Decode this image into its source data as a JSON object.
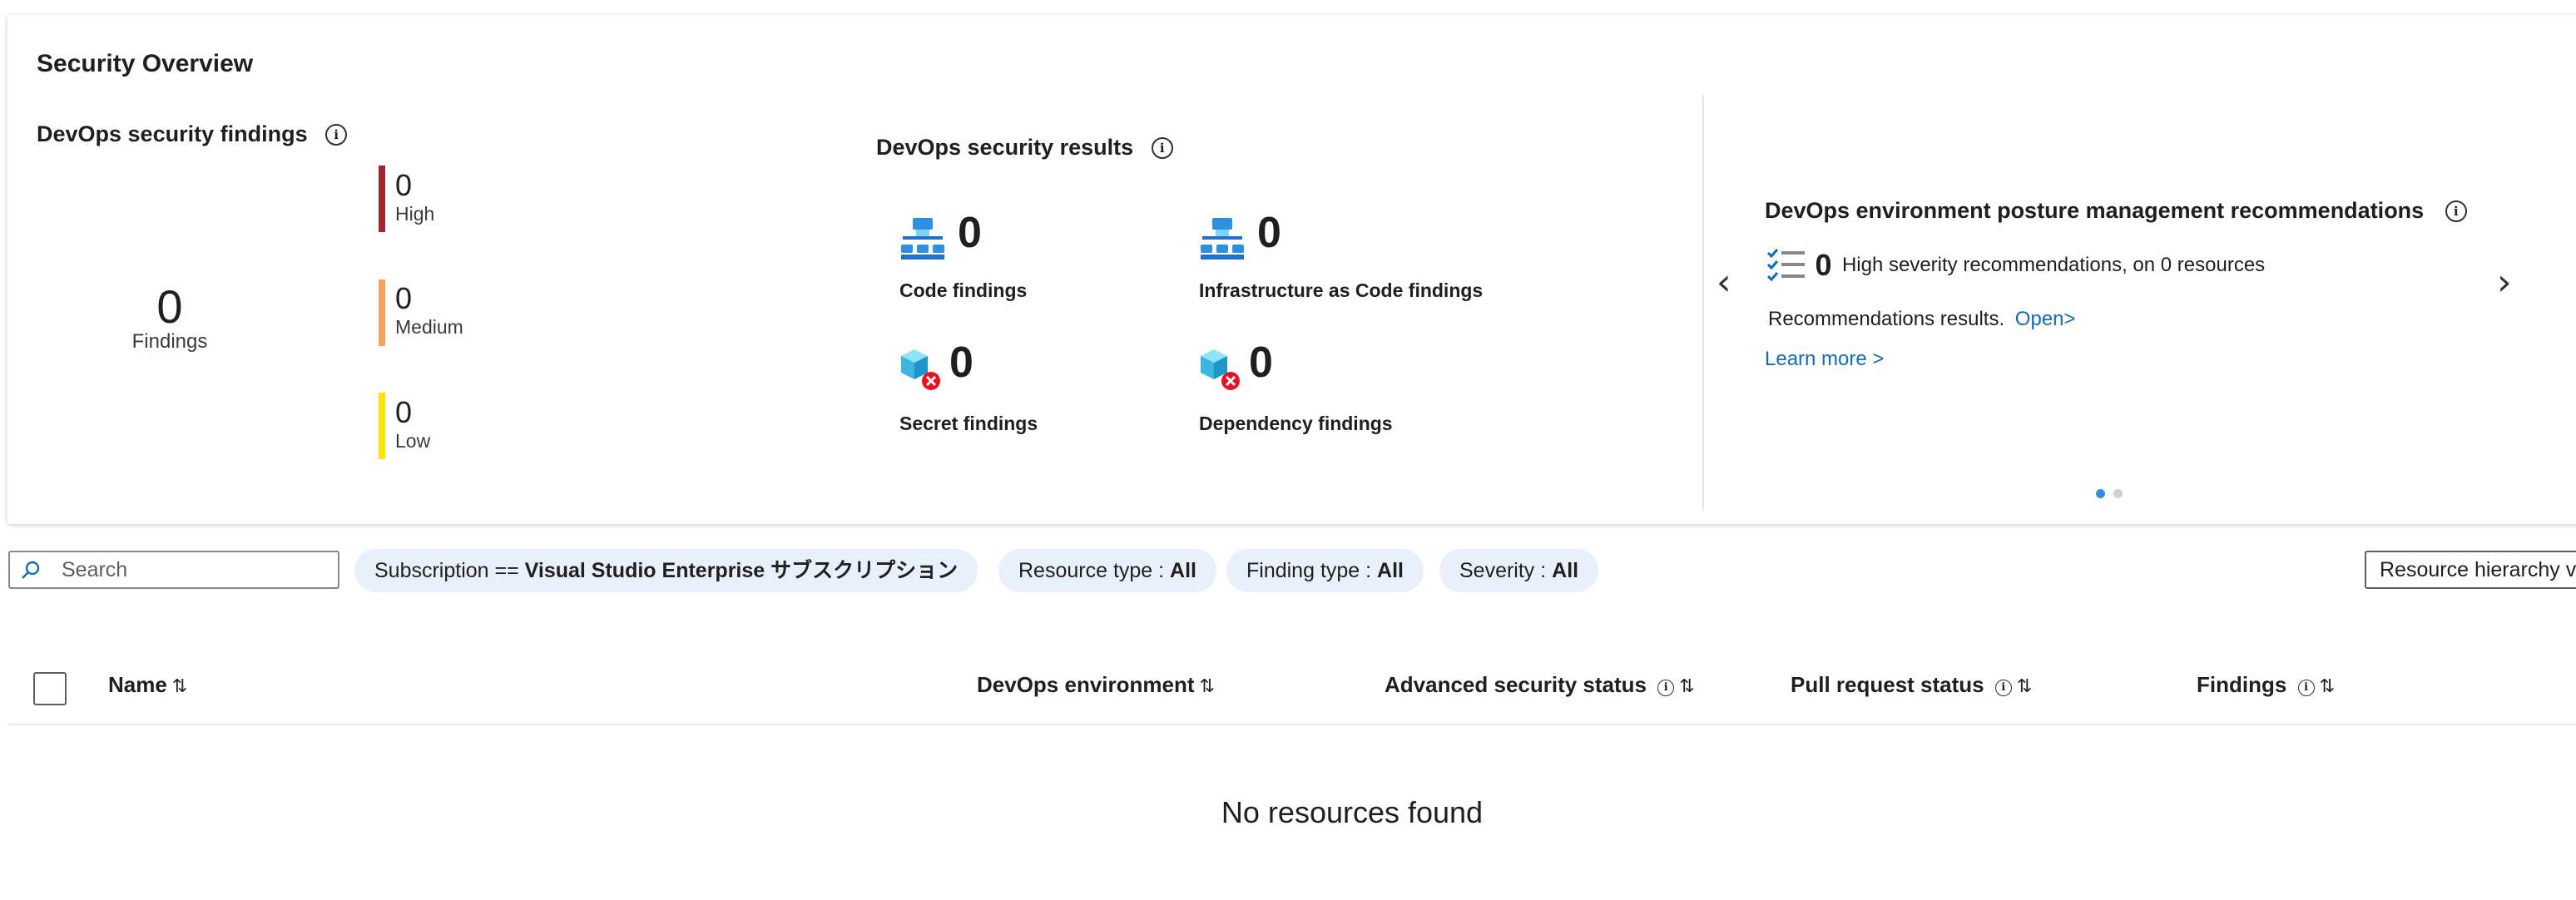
{
  "overview": {
    "title": "Security Overview",
    "findings": {
      "title": "DevOps security findings",
      "total": "0",
      "total_label": "Findings",
      "high": {
        "value": "0",
        "label": "High",
        "color": "#a4262c"
      },
      "medium": {
        "value": "0",
        "label": "Medium",
        "color": "#f7a35c"
      },
      "low": {
        "value": "0",
        "label": "Low",
        "color": "#fde300"
      }
    },
    "results": {
      "title": "DevOps security results",
      "code": {
        "value": "0",
        "label": "Code findings",
        "icon": "hierarchy-icon"
      },
      "iac": {
        "value": "0",
        "label": "Infrastructure as Code findings",
        "icon": "hierarchy-icon"
      },
      "secret": {
        "value": "0",
        "label": "Secret findings",
        "icon": "cube-error-icon"
      },
      "dependency": {
        "value": "0",
        "label": "Dependency findings",
        "icon": "cube-error-icon"
      }
    },
    "posture": {
      "title": "DevOps environment posture management recommendations",
      "count": "0",
      "count_text": "High severity recommendations, on 0 resources",
      "results_text": "Recommendations results.",
      "open_link": "Open>",
      "learn_more": "Learn more >",
      "carousel": {
        "pages": 2,
        "active": 0
      }
    }
  },
  "filters": {
    "search_placeholder": "Search",
    "subscription": {
      "prefix": "Subscription ==",
      "value": "Visual Studio Enterprise サブスクリプション"
    },
    "resource_type": {
      "prefix": "Resource type :",
      "value": "All"
    },
    "finding_type": {
      "prefix": "Finding type :",
      "value": "All"
    },
    "severity": {
      "prefix": "Severity :",
      "value": "All"
    },
    "view_toggle": "Resource hierarchy v"
  },
  "table": {
    "columns": {
      "name": "Name",
      "env": "DevOps environment",
      "adv": "Advanced security status",
      "pr": "Pull request status",
      "findings": "Findings"
    },
    "empty_text": "No resources found"
  },
  "colors": {
    "accent": "#0f6cbd",
    "pill_bg": "#e8f1fb"
  }
}
